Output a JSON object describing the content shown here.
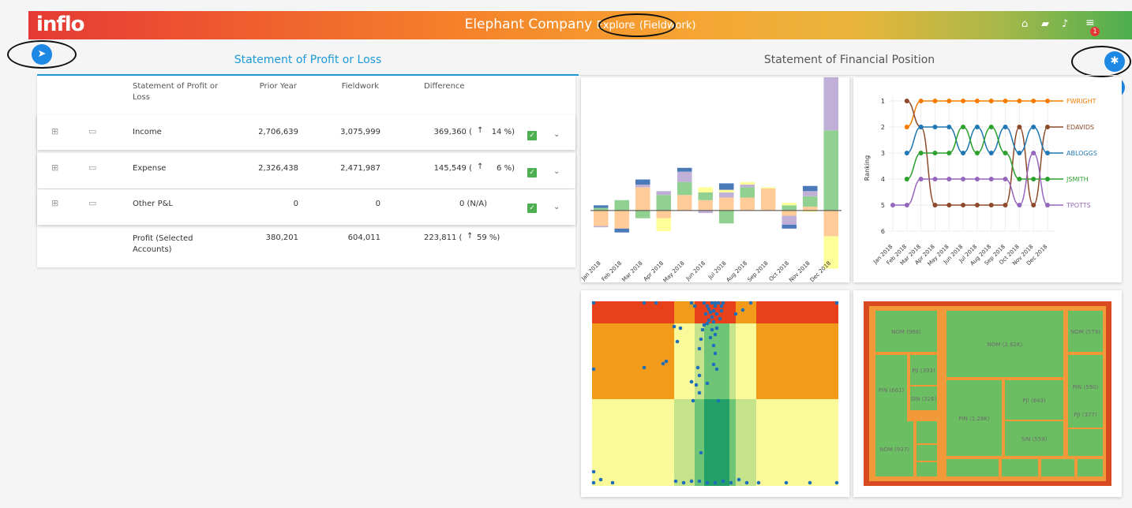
{
  "topbar": {
    "logo": "inflo",
    "company": "Elephant Company",
    "mode_prefix": "Explo",
    "mode_suffix": "re",
    "stage": "(Fieldwork)",
    "icons": [
      "home-icon",
      "book-icon",
      "bell-icon",
      "menu-icon"
    ],
    "notification_count": "1"
  },
  "tabs": {
    "profit_loss": "Statement of Profit or Loss",
    "financial_position": "Statement of Financial Position"
  },
  "table": {
    "headers": {
      "statement": "Statement of Profit or Loss",
      "prior": "Prior Year",
      "fieldwork": "Fieldwork",
      "difference": "Difference"
    },
    "rows": [
      {
        "label": "Income",
        "prior": "2,706,639",
        "fieldwork": "3,075,999",
        "diff": "369,360 (",
        "pct": "14 %)"
      },
      {
        "label": "Expense",
        "prior": "2,326,438",
        "fieldwork": "2,471,987",
        "diff": "145,549 (",
        "pct": "6 %)"
      },
      {
        "label": "Other P&L",
        "prior": "0",
        "fieldwork": "0",
        "diff": "0 (N/A)",
        "pct": ""
      }
    ],
    "total": {
      "label": "Profit (Selected Accounts)",
      "prior": "380,201",
      "fieldwork": "604,011",
      "diff": "223,811 (",
      "pct": "59 %)"
    }
  },
  "chart_data": [
    {
      "type": "bar",
      "categories": [
        "Jan 2018",
        "Feb 2018",
        "Mar 2018",
        "Apr 2018",
        "May 2018",
        "Jun 2018",
        "Jul 2018",
        "Aug 2018",
        "Sep 2018",
        "Oct 2018",
        "Nov 2018",
        "Dec 2018"
      ],
      "colors": [
        "#ffcc99",
        "#90d090",
        "#c0b0d8",
        "#ffff99",
        "#4a7ab8"
      ],
      "ylim": [
        -30,
        100
      ],
      "series": [
        {
          "values": [
            -12,
            -14,
            18,
            -6,
            12,
            8,
            10,
            10,
            17,
            -4,
            3,
            -20
          ]
        },
        {
          "values": [
            2,
            8,
            -6,
            12,
            10,
            6,
            -10,
            8,
            0,
            4,
            8,
            62
          ]
        },
        {
          "values": [
            -1,
            0,
            2,
            3,
            8,
            -2,
            4,
            2,
            0,
            -7,
            4,
            58
          ]
        },
        {
          "values": [
            0,
            0,
            0,
            -10,
            0,
            4,
            2,
            2,
            1,
            2,
            -1,
            -25
          ]
        },
        {
          "values": [
            2,
            -3,
            4,
            0,
            3,
            0,
            5,
            0,
            0,
            -3,
            4,
            2
          ]
        }
      ]
    },
    {
      "type": "line",
      "ylabel": "Ranking",
      "x": [
        "Jan 2018",
        "Feb 2018",
        "Mar 2018",
        "Apr 2018",
        "May 2018",
        "Jun 2018",
        "Jul 2018",
        "Aug 2018",
        "Sep 2018",
        "Oct 2018",
        "Nov 2018",
        "Dec 2018"
      ],
      "y_ticks": [
        1,
        2,
        3,
        4,
        5,
        6
      ],
      "series": [
        {
          "name": "FWRIGHT",
          "color": "#f57c00",
          "values": [
            null,
            2,
            1,
            1,
            1,
            1,
            1,
            1,
            1,
            1,
            1,
            1
          ]
        },
        {
          "name": "EDAVIDS",
          "color": "#8d4a2a",
          "values": [
            null,
            1,
            2,
            5,
            5,
            5,
            5,
            5,
            5,
            2,
            5,
            2
          ]
        },
        {
          "name": "ABLOGGS",
          "color": "#1f77b4",
          "values": [
            null,
            3,
            2,
            2,
            2,
            3,
            2,
            3,
            2,
            3,
            2,
            3
          ]
        },
        {
          "name": "JSMITH",
          "color": "#2ca02c",
          "values": [
            null,
            4,
            3,
            3,
            3,
            2,
            3,
            2,
            3,
            4,
            4,
            4
          ]
        },
        {
          "name": "TPOTTS",
          "color": "#9467bd",
          "values": [
            5,
            5,
            4,
            4,
            4,
            4,
            4,
            4,
            4,
            5,
            3,
            5
          ]
        }
      ]
    },
    {
      "type": "heatmap",
      "description_colors": [
        "#e8401a",
        "#f29a1a",
        "#fbfa9a",
        "#c5e38a",
        "#6fc576",
        "#23a067"
      ]
    },
    {
      "type": "treemap",
      "labels": [
        "NOM (968)",
        "PJI (393)",
        "PIN (661)",
        "SIN (326)",
        "NOM (2.62K)",
        "PIN (1.28K)",
        "PJI (843)",
        "SIN (559)",
        "NOM (579)",
        "PIN (590)",
        "PJI (377)",
        "NOM (937)"
      ]
    }
  ]
}
